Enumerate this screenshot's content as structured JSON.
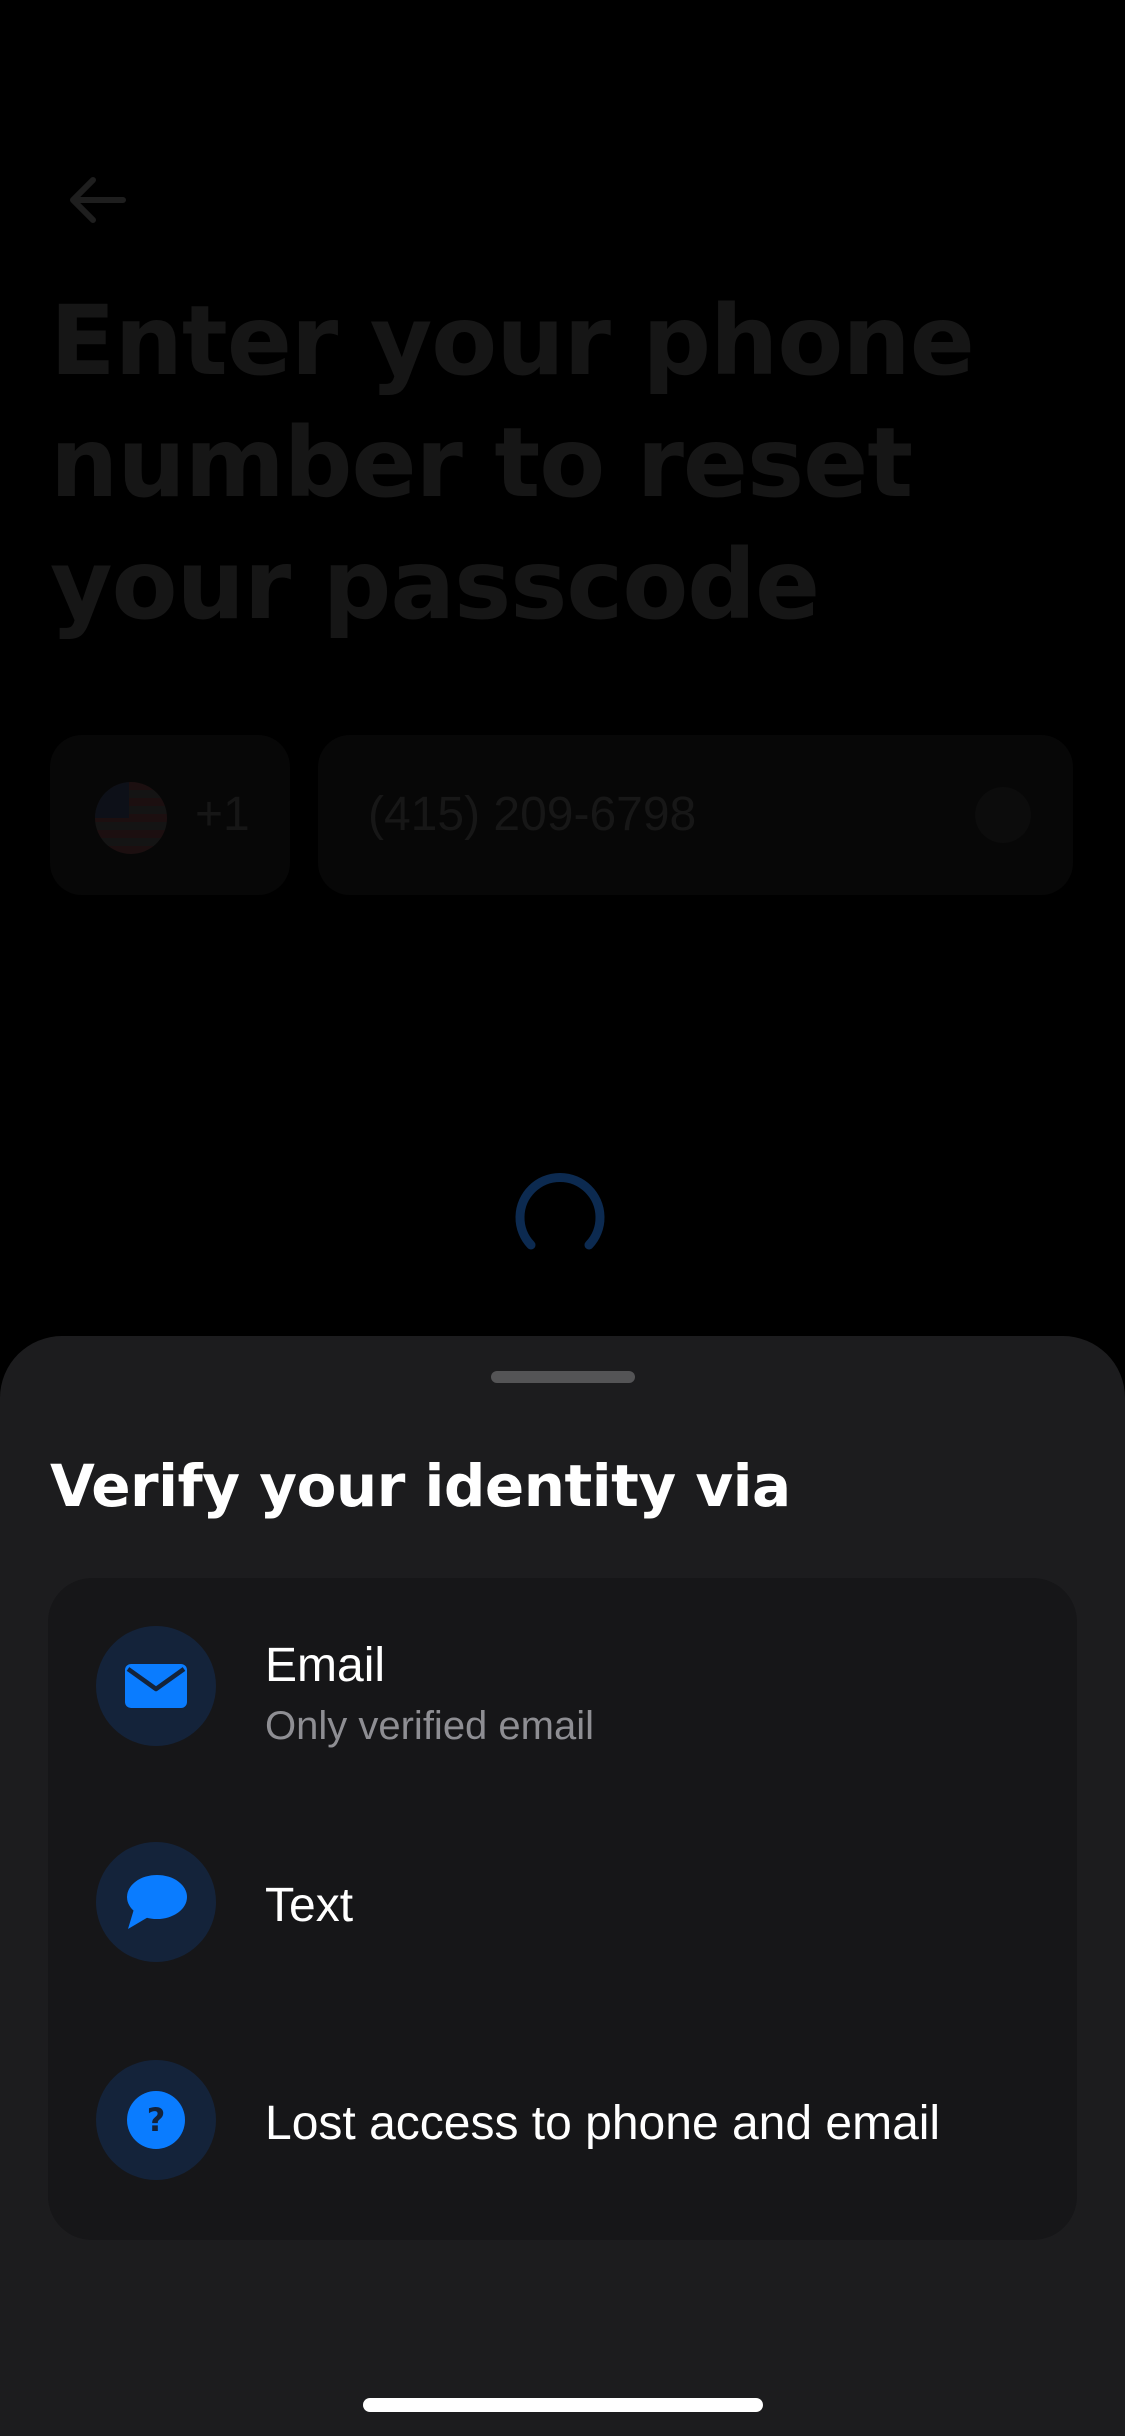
{
  "background_page": {
    "back_icon": "arrow-left-icon",
    "title": "Enter your phone number to reset your passcode",
    "country": {
      "flag_icon": "us-flag-icon",
      "dial_code": "+1"
    },
    "phone_input": {
      "value": "(415) 209-6798"
    },
    "loading": true
  },
  "sheet": {
    "title": "Verify your identity via",
    "options": [
      {
        "icon": "envelope-icon",
        "label": "Email",
        "sublabel": "Only verified email"
      },
      {
        "icon": "chat-bubble-icon",
        "label": "Text"
      },
      {
        "icon": "question-icon",
        "label": "Lost access to phone and email"
      }
    ]
  },
  "colors": {
    "accent": "#0a7cff",
    "sheet_background": "#1c1c1e",
    "card_background": "#161618",
    "icon_circle": "#14233a",
    "secondary_text": "#8e8e93"
  }
}
